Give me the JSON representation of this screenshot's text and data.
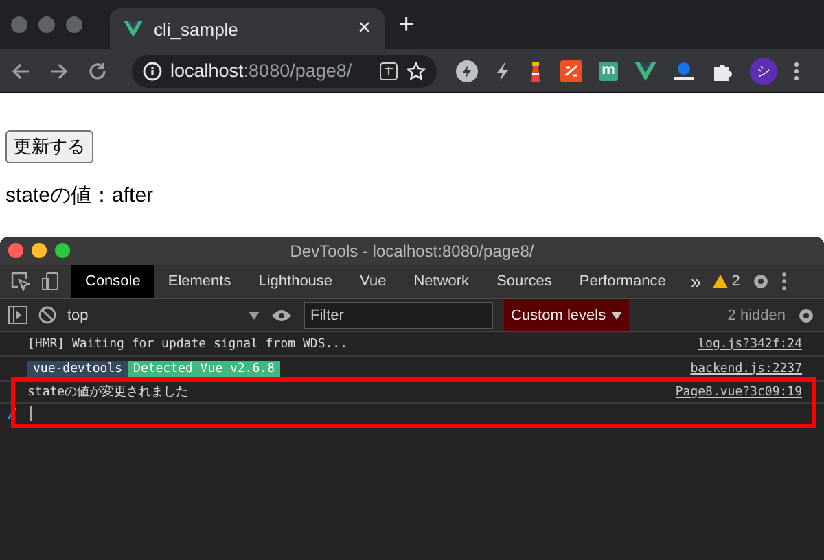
{
  "browser": {
    "tab_title": "cli_sample",
    "tab_close": "×",
    "new_tab": "+",
    "url_host": "localhost",
    "url_rest": ":8080/page8/",
    "extensions": [
      {
        "kind": "bolt-circle"
      },
      {
        "kind": "bolt"
      },
      {
        "kind": "lighthouse"
      },
      {
        "kind": "red-square"
      },
      {
        "kind": "letter",
        "text": "m"
      },
      {
        "kind": "vue"
      },
      {
        "kind": "tray"
      },
      {
        "kind": "puzzle"
      }
    ],
    "avatar": "シ"
  },
  "page": {
    "button": "更新する",
    "state_text": "stateの値：after"
  },
  "devtools": {
    "title": "DevTools - localhost:8080/page8/",
    "tabs": [
      {
        "label": "Console",
        "selected": true
      },
      {
        "label": "Elements",
        "selected": false
      },
      {
        "label": "Lighthouse",
        "selected": false
      },
      {
        "label": "Vue",
        "selected": false
      },
      {
        "label": "Network",
        "selected": false
      },
      {
        "label": "Sources",
        "selected": false
      },
      {
        "label": "Performance",
        "selected": false
      }
    ],
    "more": "»",
    "warning_count": "2",
    "context": "top",
    "filter_placeholder": "Filter",
    "levels": "Custom levels",
    "hidden": "2 hidden",
    "messages": [
      {
        "kind": "log",
        "text": "[HMR] Waiting for update signal from WDS...",
        "source": "log.js?342f:24",
        "highlighted": false
      },
      {
        "kind": "badges",
        "badges": [
          {
            "text": "vue-devtools",
            "color": "#35495e"
          },
          {
            "text": "Detected Vue v2.6.8",
            "color": "#41b883"
          }
        ],
        "source": "backend.js:2237",
        "highlighted": false
      },
      {
        "kind": "log",
        "text": "stateの値が変更されました",
        "source": "Page8.vue?3c09:19",
        "highlighted": true
      }
    ]
  }
}
